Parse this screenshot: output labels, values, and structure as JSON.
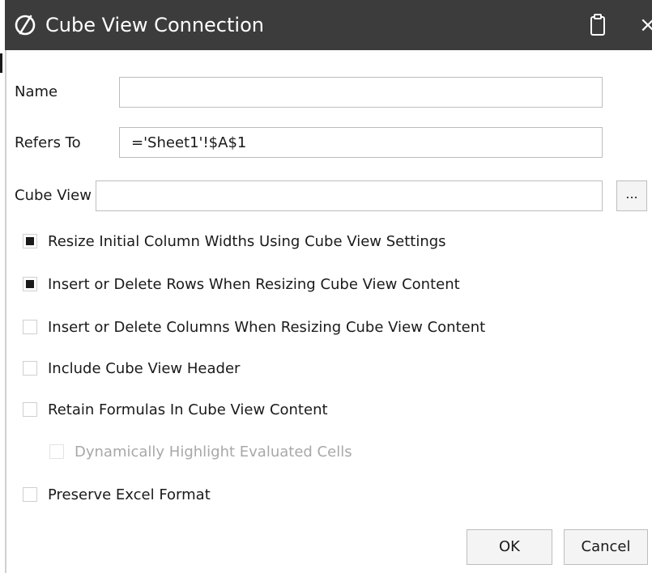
{
  "window": {
    "title": "Cube View Connection",
    "logo_icon": "onestream-logo-icon",
    "clipboard_icon": "clipboard-icon",
    "close_glyph": "×"
  },
  "fields": {
    "name": {
      "label": "Name",
      "value": ""
    },
    "refers_to": {
      "label": "Refers To",
      "value": "='Sheet1'!$A$1"
    },
    "cube_view": {
      "label": "Cube View",
      "value": "",
      "browse_label": "..."
    }
  },
  "options": [
    {
      "label": "Resize Initial Column Widths Using Cube View Settings",
      "checked": true,
      "enabled": true
    },
    {
      "label": "Insert or Delete Rows When Resizing Cube View Content",
      "checked": true,
      "enabled": true
    },
    {
      "label": "Insert or Delete Columns When Resizing Cube View Content",
      "checked": false,
      "enabled": true
    },
    {
      "label": "Include Cube View Header",
      "checked": false,
      "enabled": true
    },
    {
      "label": "Retain Formulas In Cube View Content",
      "checked": false,
      "enabled": true
    },
    {
      "label": "Dynamically Highlight Evaluated Cells",
      "checked": false,
      "enabled": false
    },
    {
      "label": "Preserve Excel Format",
      "checked": false,
      "enabled": true
    }
  ],
  "buttons": {
    "ok": "OK",
    "cancel": "Cancel"
  },
  "colors": {
    "titlebar_bg": "#3c3c3c",
    "titlebar_text": "#ffffff",
    "checkbox_fill": "#1a1a1a",
    "disabled_text": "#a8a8a8"
  }
}
